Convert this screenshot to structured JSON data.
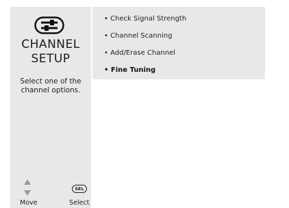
{
  "sidebar": {
    "icon": "tools-icon",
    "title": "CHANNEL\nSETUP",
    "description": "Select one of the\nchannel options.",
    "footer": {
      "move_label": "Move",
      "select_label": "Select",
      "sel_badge": "SEL"
    }
  },
  "menu": {
    "items": [
      {
        "label": "• Check Signal Strength",
        "active": false
      },
      {
        "label": "• Channel Scanning",
        "active": false
      },
      {
        "label": "• Add/Erase Channel",
        "active": false
      },
      {
        "label": "• Fine Tuning",
        "active": true
      }
    ]
  }
}
